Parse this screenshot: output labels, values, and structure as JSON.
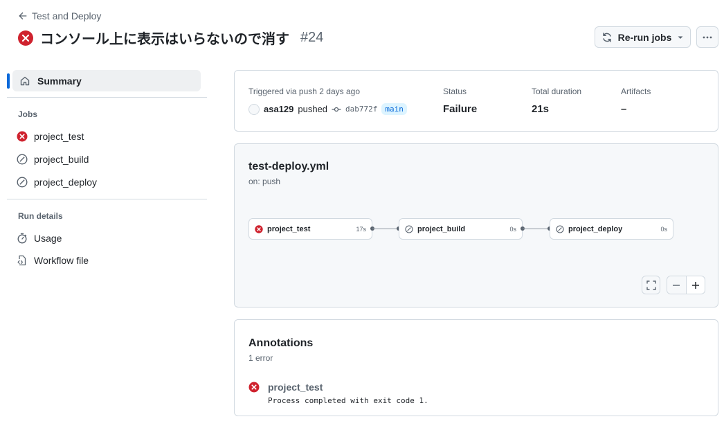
{
  "header": {
    "back_label": "Test and Deploy",
    "title": "コンソール上に表示はいらないので消す",
    "run_number": "#24",
    "rerun_label": "Re-run jobs"
  },
  "sidebar": {
    "summary_label": "Summary",
    "jobs_label": "Jobs",
    "jobs": [
      {
        "label": "project_test",
        "status": "failure"
      },
      {
        "label": "project_build",
        "status": "skipped"
      },
      {
        "label": "project_deploy",
        "status": "skipped"
      }
    ],
    "run_details_label": "Run details",
    "run_details": [
      {
        "label": "Usage",
        "icon": "stopwatch-icon"
      },
      {
        "label": "Workflow file",
        "icon": "file-code-icon"
      }
    ]
  },
  "summary": {
    "trigger_label": "Triggered via push 2 days ago",
    "actor": "asa129",
    "action": "pushed",
    "commit": "dab772f",
    "branch": "main",
    "status_label": "Status",
    "status_value": "Failure",
    "duration_label": "Total duration",
    "duration_value": "21s",
    "artifacts_label": "Artifacts",
    "artifacts_value": "–"
  },
  "workflow": {
    "file": "test-deploy.yml",
    "trigger": "on: push",
    "nodes": [
      {
        "label": "project_test",
        "duration": "17s",
        "status": "failure"
      },
      {
        "label": "project_build",
        "duration": "0s",
        "status": "skipped"
      },
      {
        "label": "project_deploy",
        "duration": "0s",
        "status": "skipped"
      }
    ]
  },
  "annotations": {
    "title": "Annotations",
    "count": "1 error",
    "items": [
      {
        "job": "project_test",
        "message": "Process completed with exit code 1."
      }
    ]
  },
  "colors": {
    "failure": "#cf222e",
    "skipped": "#59636e",
    "accent": "#0969da"
  }
}
